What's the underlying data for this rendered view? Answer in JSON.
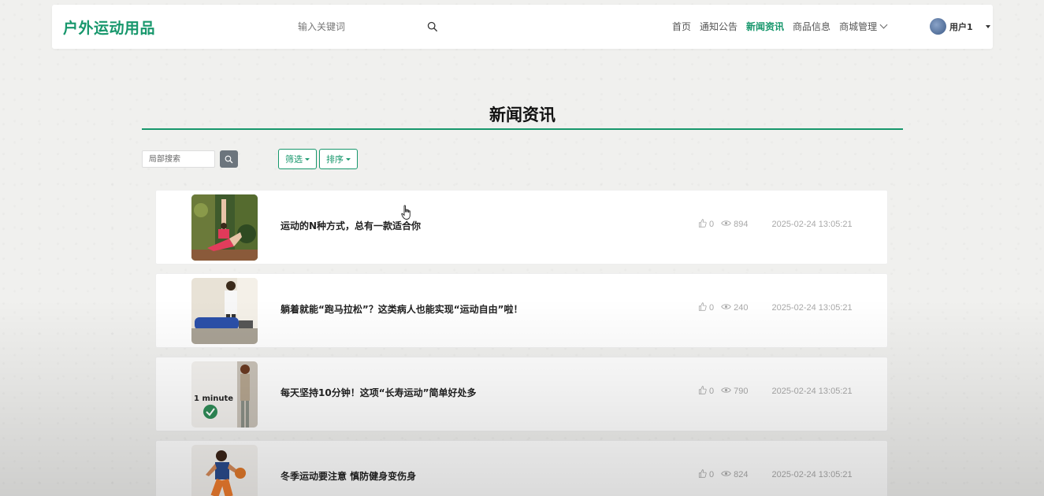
{
  "header": {
    "logo": "户外运动用品",
    "search_placeholder": "输入关键词",
    "nav": [
      "首页",
      "通知公告",
      "新闻资讯",
      "商品信息",
      "商城管理"
    ],
    "active_nav": "新闻资讯",
    "user": "用户1"
  },
  "page": {
    "title": "新闻资讯",
    "local_search_placeholder": "局部搜索",
    "filter_label": "筛选",
    "sort_label": "排序"
  },
  "colors": {
    "accent": "#17976c"
  },
  "news": [
    {
      "title": "运动的N种方式，总有一款适合你",
      "likes": "0",
      "views": "894",
      "date": "2025-02-24 13:05:21"
    },
    {
      "title": "躺着就能“跑马拉松”？这类病人也能实现“运动自由”啦！",
      "likes": "0",
      "views": "240",
      "date": "2025-02-24 13:05:21"
    },
    {
      "title": "每天坚持10分钟！这项“长寿运动”简单好处多",
      "likes": "0",
      "views": "790",
      "date": "2025-02-24 13:05:21",
      "thumb_caption": "1 minute"
    },
    {
      "title": "冬季运动要注意 慎防健身变伤身",
      "likes": "0",
      "views": "824",
      "date": "2025-02-24 13:05:21"
    }
  ]
}
